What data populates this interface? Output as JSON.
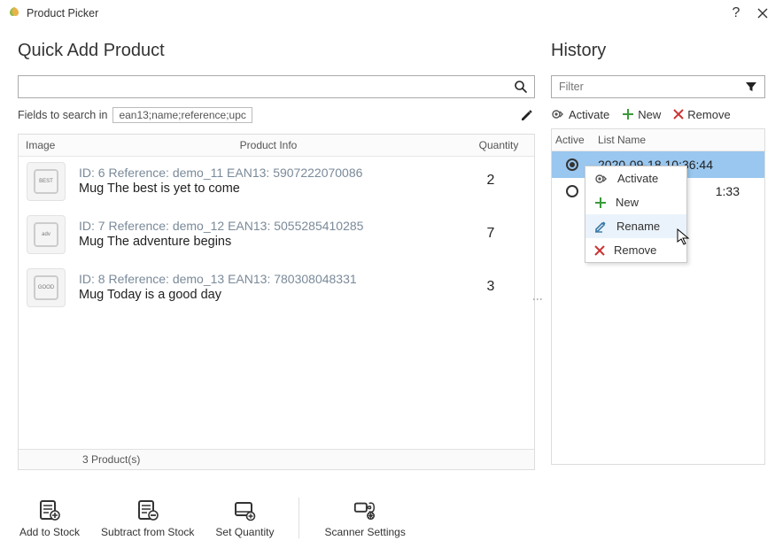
{
  "window": {
    "title": "Product Picker"
  },
  "left": {
    "heading": "Quick Add Product",
    "search_value": "",
    "fields_label": "Fields to search in",
    "fields_value": "ean13;name;reference;upc",
    "columns": {
      "image": "Image",
      "info": "Product Info",
      "qty": "Quantity"
    },
    "rows": [
      {
        "meta": "ID: 6 Reference: demo_11 EAN13: 5907222070086",
        "name": "Mug The best is yet to come",
        "qty": "2",
        "thumb_text": "BEST"
      },
      {
        "meta": "ID: 7 Reference: demo_12 EAN13: 5055285410285",
        "name": "Mug The adventure begins",
        "qty": "7",
        "thumb_text": "adv"
      },
      {
        "meta": "ID: 8 Reference: demo_13 EAN13: 780308048331",
        "name": "Mug Today is a good day",
        "qty": "3",
        "thumb_text": "GOOD"
      }
    ],
    "summary": "3 Product(s)"
  },
  "right": {
    "heading": "History",
    "filter_placeholder": "Filter",
    "actions": {
      "activate": "Activate",
      "new": "New",
      "remove": "Remove"
    },
    "columns": {
      "active": "Active",
      "name": "List Name"
    },
    "rows": [
      {
        "name": "2020-09-18 10:36:44",
        "active": true,
        "selected": true
      },
      {
        "name": "1:33",
        "active": false,
        "selected": false
      }
    ]
  },
  "context_menu": {
    "items": [
      {
        "label": "Activate",
        "icon": "activate"
      },
      {
        "label": "New",
        "icon": "plus"
      },
      {
        "label": "Rename",
        "icon": "pencil",
        "hover": true
      },
      {
        "label": "Remove",
        "icon": "x"
      }
    ]
  },
  "bottom": {
    "add": "Add to Stock",
    "sub": "Subtract from Stock",
    "set": "Set Quantity",
    "scan": "Scanner Settings"
  }
}
